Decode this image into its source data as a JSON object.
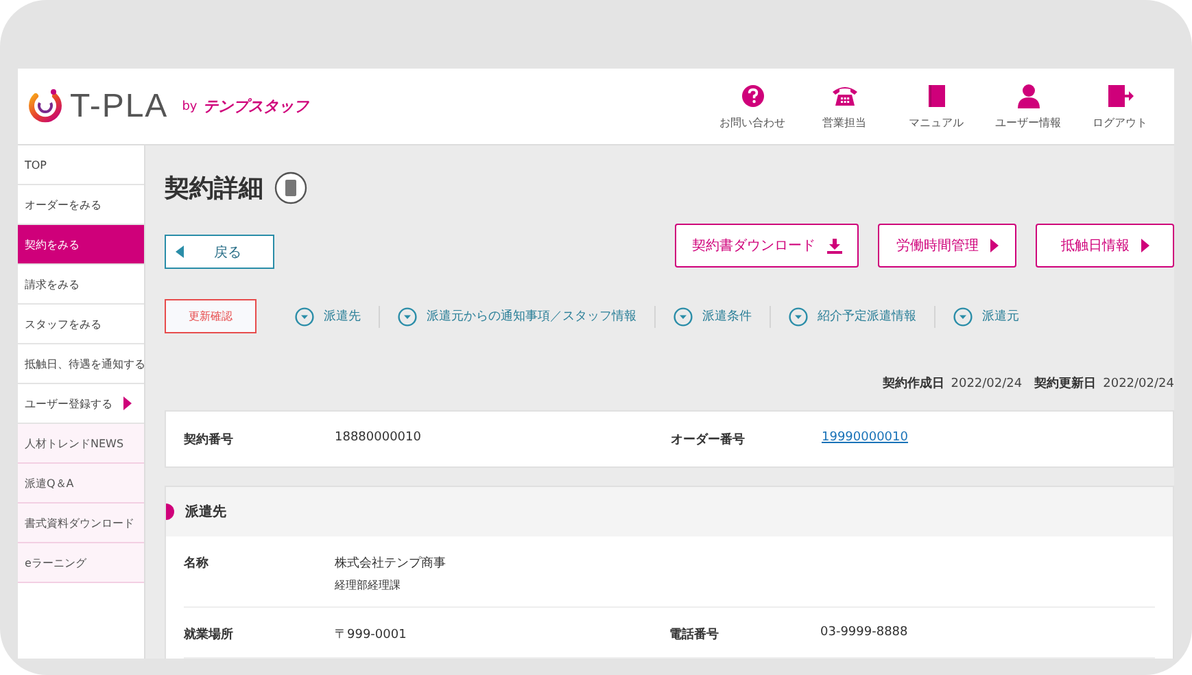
{
  "logo": {
    "name": "T-PLA",
    "by": "by",
    "brand": "テンプスタッフ"
  },
  "header_nav": [
    {
      "kind": "help",
      "label": "お問い合わせ"
    },
    {
      "kind": "phone",
      "label": "営業担当"
    },
    {
      "kind": "manual",
      "label": "マニュアル"
    },
    {
      "kind": "user",
      "label": "ユーザー情報"
    },
    {
      "kind": "logout",
      "label": "ログアウト"
    }
  ],
  "sidebar": {
    "items": [
      {
        "label": "TOP",
        "kind": "nav",
        "selected": false
      },
      {
        "label": "オーダーをみる",
        "kind": "nav",
        "selected": false
      },
      {
        "label": "契約をみる",
        "kind": "nav",
        "selected": true
      },
      {
        "label": "請求をみる",
        "kind": "nav",
        "selected": false
      },
      {
        "label": "スタッフをみる",
        "kind": "nav",
        "selected": false
      },
      {
        "label": "抵触日、待遇を通知する",
        "kind": "nav",
        "selected": false
      },
      {
        "label": "ユーザー登録する",
        "kind": "submenu",
        "selected": false
      },
      {
        "label": "人材トレンドNEWS",
        "kind": "resource",
        "selected": false
      },
      {
        "label": "派遣Q＆A",
        "kind": "resource",
        "selected": false
      },
      {
        "label": "書式資料ダウンロード",
        "kind": "resource",
        "selected": false
      },
      {
        "label": "eラーニング",
        "kind": "resource",
        "selected": false
      }
    ]
  },
  "page_title": "契約詳細",
  "back_button": "戻る",
  "action_buttons": [
    {
      "label": "契約書ダウンロード",
      "kind": "download"
    },
    {
      "label": "労働時間管理",
      "kind": "next"
    },
    {
      "label": "抵触日情報",
      "kind": "next"
    }
  ],
  "update_button": "更新確認",
  "anchor_links": [
    "派遣先",
    "派遣元からの通知事項／スタッフ情報",
    "派遣条件",
    "紹介予定派遣情報",
    "派遣元"
  ],
  "dates": [
    {
      "label": "契約作成日",
      "value": "2022/02/24"
    },
    {
      "label": "契約更新日",
      "value": "2022/02/24"
    }
  ],
  "summary": [
    {
      "label": "契約番号",
      "value": "18880000010",
      "link": false
    },
    {
      "label": "オーダー番号",
      "value": "19990000010",
      "link": true
    }
  ],
  "section": {
    "title": "派遣先",
    "rows": [
      {
        "fields": [
          {
            "label": "名称",
            "lines": [
              "株式会社テンプ商事",
              "経理部経理課"
            ]
          }
        ]
      },
      {
        "fields": [
          {
            "label": "就業場所",
            "lines": [
              "〒999-0001"
            ]
          },
          {
            "label": "電話番号",
            "lines": [
              "03-9999-8888"
            ]
          }
        ]
      }
    ]
  }
}
